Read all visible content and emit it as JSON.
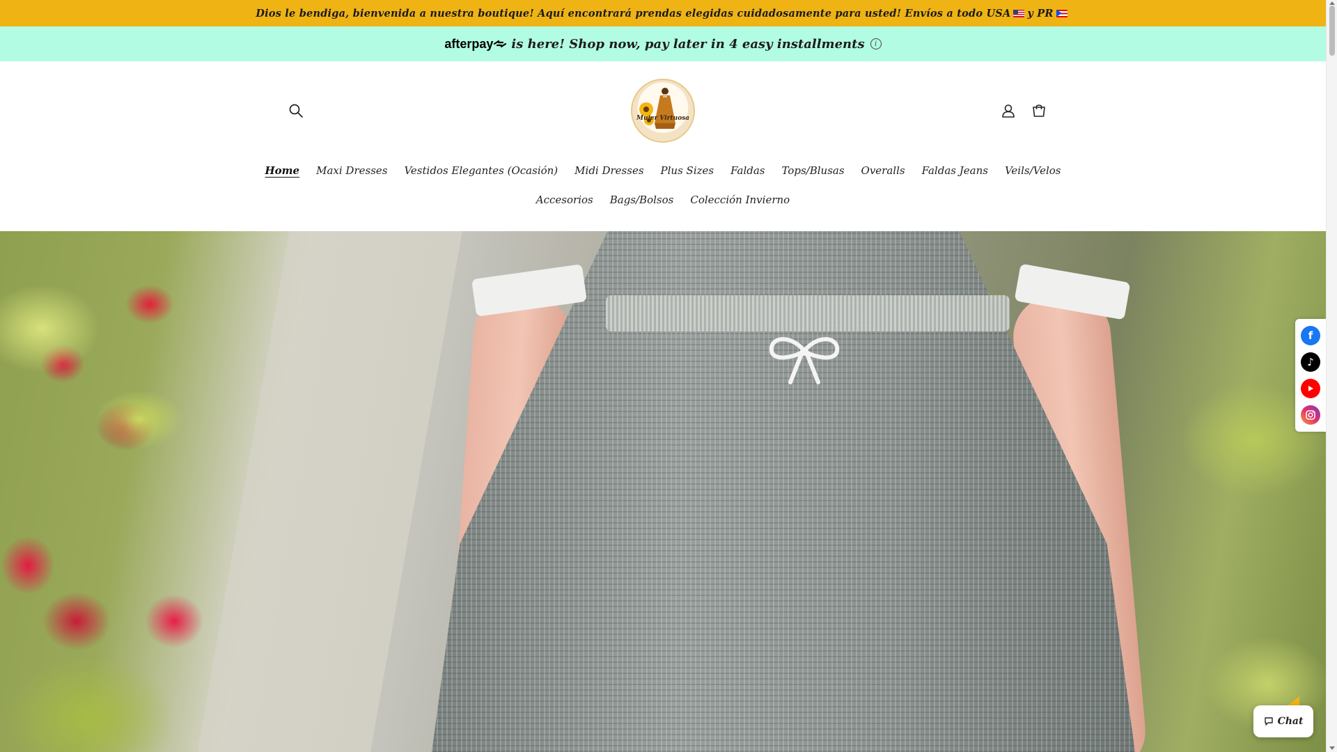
{
  "announcement": {
    "text": "Dios le bendiga, bienvenida a nuestra boutique! Aquí encontrará prendas elegidas cuidadosamente para usted! Envíos a todo USA",
    "text_mid": "y PR"
  },
  "afterpay": {
    "logo": "afterpay",
    "message": "is here! Shop now, pay later in 4 easy installments",
    "info": "i"
  },
  "header": {
    "logo_text": "Mujer Virtuosa",
    "search_icon": "search-icon",
    "account_icon": "account-icon",
    "cart_icon": "cart-icon"
  },
  "nav": {
    "row1": [
      "Home",
      "Maxi Dresses",
      "Vestidos Elegantes (Ocasión)",
      "Midi Dresses",
      "Plus Sizes",
      "Faldas",
      "Tops/Blusas",
      "Overalls",
      "Faldas Jeans",
      "Veils/Velos"
    ],
    "row2": [
      "Accesorios",
      "Bags/Bolsos",
      "Colección Invierno"
    ],
    "active": "Home"
  },
  "social": [
    "facebook-icon",
    "tiktok-icon",
    "youtube-icon",
    "instagram-icon"
  ],
  "chat": {
    "label": "Chat"
  },
  "colors": {
    "announcement_bg": "#f0b314",
    "afterpay_bg": "#b2fce4",
    "facebook": "#1877f2",
    "tiktok": "#000000",
    "youtube": "#ff0000",
    "instagram": "#c13584"
  }
}
